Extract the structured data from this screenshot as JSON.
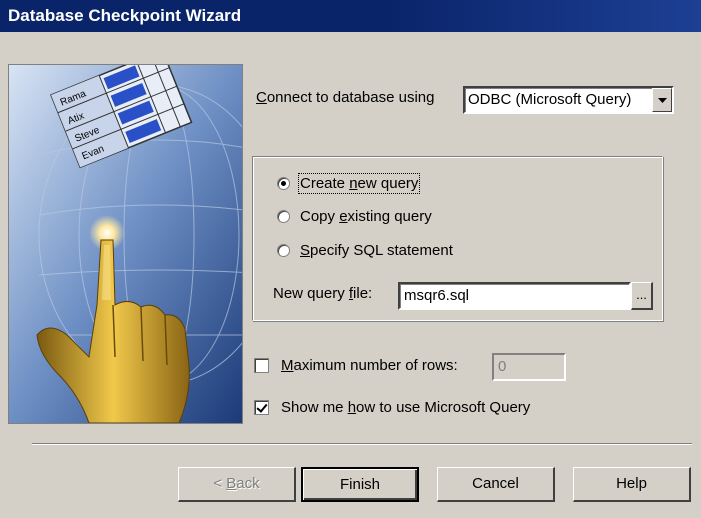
{
  "window": {
    "title": "Database Checkpoint Wizard"
  },
  "connect": {
    "label_pre": "",
    "label_u": "C",
    "label_post": "onnect to database using",
    "value": "ODBC (Microsoft Query)"
  },
  "query_options": [
    {
      "pre": "Create ",
      "u": "n",
      "post": "ew query",
      "selected": true
    },
    {
      "pre": "Copy ",
      "u": "e",
      "post": "xisting query",
      "selected": false
    },
    {
      "pre": "",
      "u": "S",
      "post": "pecify SQL statement",
      "selected": false
    }
  ],
  "query_file": {
    "label_pre": "New query ",
    "label_u": "f",
    "label_post": "ile:",
    "value": "msqr6.sql",
    "browse_label": "..."
  },
  "max_rows": {
    "label_pre": "",
    "label_u": "M",
    "label_post": "aximum number of rows:",
    "value": "0",
    "checked": false
  },
  "show_me": {
    "label_pre": "Show me ",
    "label_u": "h",
    "label_post": "ow to use Microsoft Query",
    "checked": true
  },
  "buttons": {
    "back_pre": "< ",
    "back_u": "B",
    "back_post": "ack",
    "finish": "Finish",
    "cancel": "Cancel",
    "help": "Help"
  },
  "art": {
    "names": [
      "Rama",
      "Atix",
      "Steve",
      "Evan"
    ]
  }
}
